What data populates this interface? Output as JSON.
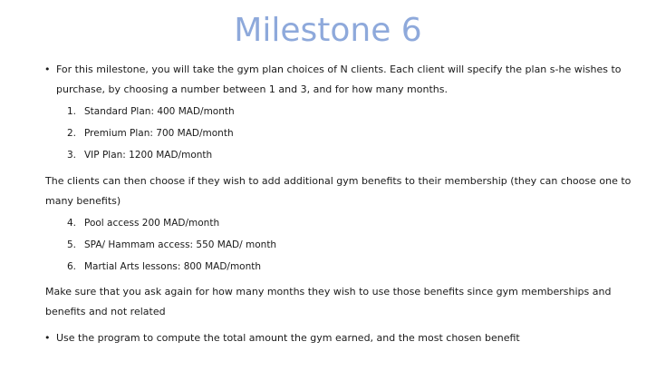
{
  "title": "Milestone 6",
  "intro": {
    "bullet": "•",
    "line1": "For this milestone, you will take the gym plan choices of N clients. Each client will specify the plan s-he wishes to",
    "line2": "purchase, by choosing a number between 1 and 3, and for how many months."
  },
  "plans": [
    {
      "num": "1.",
      "label": "Standard Plan: 400 MAD/month"
    },
    {
      "num": "2.",
      "label": "Premium Plan: 700 MAD/month"
    },
    {
      "num": "3.",
      "label": "VIP Plan: 1200 MAD/month"
    }
  ],
  "benefits_intro": {
    "line1": "The clients can then choose if  they wish to add additional gym benefits to their membership (they can choose one to",
    "line2": "many benefits)"
  },
  "benefits": [
    {
      "num": "4.",
      "label": "Pool access 200 MAD/month"
    },
    {
      "num": "5.",
      "label": "SPA/ Hammam access: 550 MAD/ month"
    },
    {
      "num": "6.",
      "label": "Martial Arts lessons: 800 MAD/month"
    }
  ],
  "reminder": {
    "line1": "Make sure that you ask again for how many months they wish to use those benefits since gym memberships and",
    "line2": "benefits and not related"
  },
  "final": {
    "bullet": "•",
    "text": "Use the program to compute the total amount the gym earned, and the most chosen benefit"
  }
}
